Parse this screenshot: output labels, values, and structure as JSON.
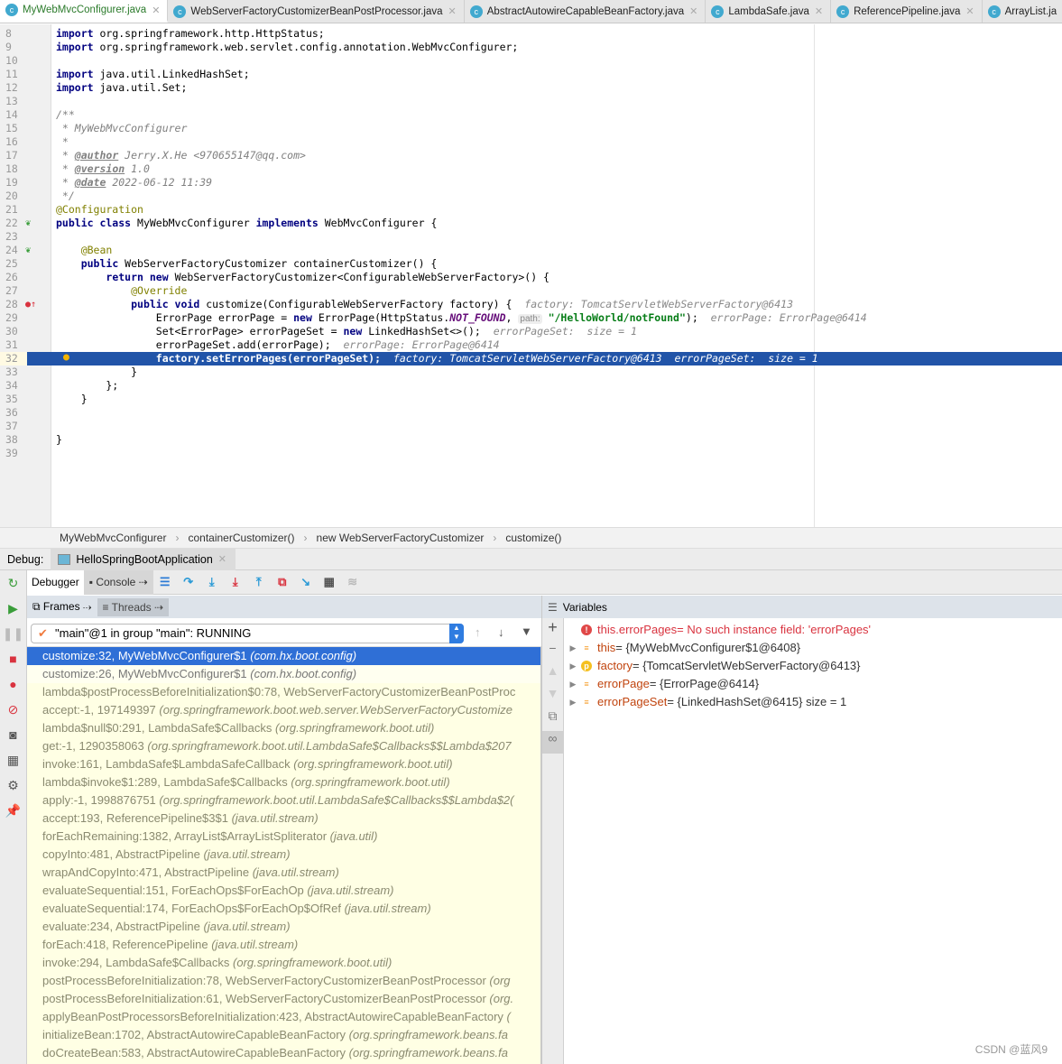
{
  "tabs": [
    "MyWebMvcConfigurer.java",
    "WebServerFactoryCustomizerBeanPostProcessor.java",
    "AbstractAutowireCapableBeanFactory.java",
    "LambdaSafe.java",
    "ReferencePipeline.java",
    "ArrayList.ja"
  ],
  "code": [
    {
      "n": "8",
      "s": [
        [
          "kw",
          "import"
        ],
        [
          "",
          "org.springframework.http.HttpStatus;"
        ]
      ]
    },
    {
      "n": "9",
      "s": [
        [
          "kw",
          "import"
        ],
        [
          "",
          "org.springframework.web.servlet.config.annotation.WebMvcConfigurer;"
        ]
      ]
    },
    {
      "n": "10",
      "s": []
    },
    {
      "n": "11",
      "s": [
        [
          "kw",
          "import"
        ],
        [
          "",
          "java.util.LinkedHashSet;"
        ]
      ]
    },
    {
      "n": "12",
      "s": [
        [
          "kw",
          "import"
        ],
        [
          "",
          "java.util.Set;"
        ]
      ]
    },
    {
      "n": "13",
      "s": []
    },
    {
      "n": "14",
      "s": [
        [
          "cm",
          "/**"
        ]
      ]
    },
    {
      "n": "15",
      "s": [
        [
          "cm",
          " * MyWebMvcConfigurer"
        ]
      ]
    },
    {
      "n": "16",
      "s": [
        [
          "cm",
          " *"
        ]
      ]
    },
    {
      "n": "17",
      "s": [
        [
          "cm",
          " * "
        ],
        [
          "tag",
          "@author"
        ],
        [
          "cm",
          " Jerry.X.He <970655147@qq.com>"
        ]
      ]
    },
    {
      "n": "18",
      "s": [
        [
          "cm",
          " * "
        ],
        [
          "tag",
          "@version"
        ],
        [
          "cm",
          " 1.0"
        ]
      ]
    },
    {
      "n": "19",
      "s": [
        [
          "cm",
          " * "
        ],
        [
          "tag",
          "@date"
        ],
        [
          "cm",
          " 2022-06-12 11:39"
        ]
      ]
    },
    {
      "n": "20",
      "s": [
        [
          "cm",
          " */"
        ]
      ]
    },
    {
      "n": "21",
      "s": [
        [
          "an",
          "@Configuration"
        ]
      ]
    },
    {
      "n": "22",
      "s": [
        [
          "kw",
          "public class"
        ],
        [
          "",
          " MyWebMvcConfigurer "
        ],
        [
          "kw",
          "implements"
        ],
        [
          "",
          " WebMvcConfigurer {"
        ]
      ]
    },
    {
      "n": "23",
      "s": []
    },
    {
      "n": "24",
      "s": [
        [
          "",
          "    "
        ],
        [
          "an",
          "@Bean"
        ]
      ]
    },
    {
      "n": "25",
      "s": [
        [
          "",
          "    "
        ],
        [
          "kw",
          "public"
        ],
        [
          "",
          " WebServerFactoryCustomizer containerCustomizer() {"
        ]
      ]
    },
    {
      "n": "26",
      "s": [
        [
          "",
          "        "
        ],
        [
          "kw",
          "return new"
        ],
        [
          "",
          " WebServerFactoryCustomizer<ConfigurableWebServerFactory>() {"
        ]
      ]
    },
    {
      "n": "27",
      "s": [
        [
          "",
          "            "
        ],
        [
          "an",
          "@Override"
        ]
      ]
    },
    {
      "n": "28",
      "s": [
        [
          "",
          "            "
        ],
        [
          "kw",
          "public void"
        ],
        [
          "",
          " customize(ConfigurableWebServerFactory factory) {  "
        ],
        [
          "hint",
          "factory: TomcatServletWebServerFactory@6413"
        ]
      ]
    },
    {
      "n": "29",
      "s": [
        [
          "",
          "                ErrorPage errorPage = "
        ],
        [
          "kw",
          "new"
        ],
        [
          "",
          " ErrorPage(HttpStatus."
        ],
        [
          "cn",
          "NOT_FOUND"
        ],
        [
          "",
          ", "
        ],
        [
          "ph",
          "path:"
        ],
        [
          "",
          " "
        ],
        [
          "str",
          "\"/HelloWorld/notFound\""
        ],
        [
          "",
          "); "
        ],
        [
          "hint",
          " errorPage: ErrorPage@6414"
        ]
      ]
    },
    {
      "n": "30",
      "s": [
        [
          "",
          "                Set<ErrorPage> errorPageSet = "
        ],
        [
          "kw",
          "new"
        ],
        [
          "",
          " LinkedHashSet<>();  "
        ],
        [
          "hint",
          "errorPageSet:  size = 1"
        ]
      ]
    },
    {
      "n": "31",
      "s": [
        [
          "",
          "                errorPageSet.add(errorPage);  "
        ],
        [
          "hint",
          "errorPage: ErrorPage@6414"
        ]
      ]
    },
    {
      "n": "32",
      "cur": true,
      "s": [
        [
          "",
          "                "
        ],
        [
          "kw",
          "factory.setErrorPages(errorPageSet);"
        ],
        [
          "",
          "  "
        ],
        [
          "hint",
          "factory: TomcatServletWebServerFactory@6413  errorPageSet:  size = 1"
        ]
      ]
    },
    {
      "n": "33",
      "s": [
        [
          "",
          "            }"
        ]
      ]
    },
    {
      "n": "34",
      "s": [
        [
          "",
          "        };"
        ]
      ]
    },
    {
      "n": "35",
      "s": [
        [
          "",
          "    }"
        ]
      ]
    },
    {
      "n": "36",
      "s": []
    },
    {
      "n": "37",
      "s": []
    },
    {
      "n": "38",
      "s": [
        [
          "",
          "}"
        ]
      ]
    },
    {
      "n": "39",
      "s": []
    }
  ],
  "breadcrumb": [
    "MyWebMvcConfigurer",
    "containerCustomizer()",
    "new WebServerFactoryCustomizer",
    "customize()"
  ],
  "debug": {
    "label": "Debug:",
    "session": "HelloSpringBootApplication",
    "debugger_tab": "Debugger",
    "console_tab": "Console",
    "frames_tab": "Frames",
    "threads_tab": "Threads",
    "variables_title": "Variables",
    "thread": "\"main\"@1 in group \"main\": RUNNING"
  },
  "frames": [
    [
      "customize:32, MyWebMvcConfigurer$1 ",
      "(com.hx.boot.config)"
    ],
    [
      "customize:26, MyWebMvcConfigurer$1 ",
      "(com.hx.boot.config)"
    ],
    [
      "lambda$postProcessBeforeInitialization$0:78, WebServerFactoryCustomizerBeanPostProc",
      ""
    ],
    [
      "accept:-1, 197149397 ",
      "(org.springframework.boot.web.server.WebServerFactoryCustomize"
    ],
    [
      "lambda$null$0:291, LambdaSafe$Callbacks ",
      "(org.springframework.boot.util)"
    ],
    [
      "get:-1, 1290358063 ",
      "(org.springframework.boot.util.LambdaSafe$Callbacks$$Lambda$207"
    ],
    [
      "invoke:161, LambdaSafe$LambdaSafeCallback ",
      "(org.springframework.boot.util)"
    ],
    [
      "lambda$invoke$1:289, LambdaSafe$Callbacks ",
      "(org.springframework.boot.util)"
    ],
    [
      "apply:-1, 1998876751 ",
      "(org.springframework.boot.util.LambdaSafe$Callbacks$$Lambda$2("
    ],
    [
      "accept:193, ReferencePipeline$3$1 ",
      "(java.util.stream)"
    ],
    [
      "forEachRemaining:1382, ArrayList$ArrayListSpliterator ",
      "(java.util)"
    ],
    [
      "copyInto:481, AbstractPipeline ",
      "(java.util.stream)"
    ],
    [
      "wrapAndCopyInto:471, AbstractPipeline ",
      "(java.util.stream)"
    ],
    [
      "evaluateSequential:151, ForEachOps$ForEachOp ",
      "(java.util.stream)"
    ],
    [
      "evaluateSequential:174, ForEachOps$ForEachOp$OfRef ",
      "(java.util.stream)"
    ],
    [
      "evaluate:234, AbstractPipeline ",
      "(java.util.stream)"
    ],
    [
      "forEach:418, ReferencePipeline ",
      "(java.util.stream)"
    ],
    [
      "invoke:294, LambdaSafe$Callbacks ",
      "(org.springframework.boot.util)"
    ],
    [
      "postProcessBeforeInitialization:78, WebServerFactoryCustomizerBeanPostProcessor ",
      "(org"
    ],
    [
      "postProcessBeforeInitialization:61, WebServerFactoryCustomizerBeanPostProcessor ",
      "(org."
    ],
    [
      "applyBeanPostProcessorsBeforeInitialization:423, AbstractAutowireCapableBeanFactory ",
      "("
    ],
    [
      "initializeBean:1702, AbstractAutowireCapableBeanFactory ",
      "(org.springframework.beans.fa"
    ],
    [
      "doCreateBean:583, AbstractAutowireCapableBeanFactory ",
      "(org.springframework.beans.fa"
    ]
  ],
  "variables": [
    {
      "icon": "error",
      "name": "this.errorPages",
      "value": " = No such instance field: 'errorPages'",
      "err": true
    },
    {
      "icon": "field",
      "name": "this",
      "value": " = {MyWebMvcConfigurer$1@6408}"
    },
    {
      "icon": "param",
      "name": "factory",
      "value": " = {TomcatServletWebServerFactory@6413}"
    },
    {
      "icon": "field",
      "name": "errorPage",
      "value": " = {ErrorPage@6414}"
    },
    {
      "icon": "field",
      "name": "errorPageSet",
      "value": " = {LinkedHashSet@6415}  size = 1"
    }
  ],
  "watermark": "CSDN @蓝风9"
}
